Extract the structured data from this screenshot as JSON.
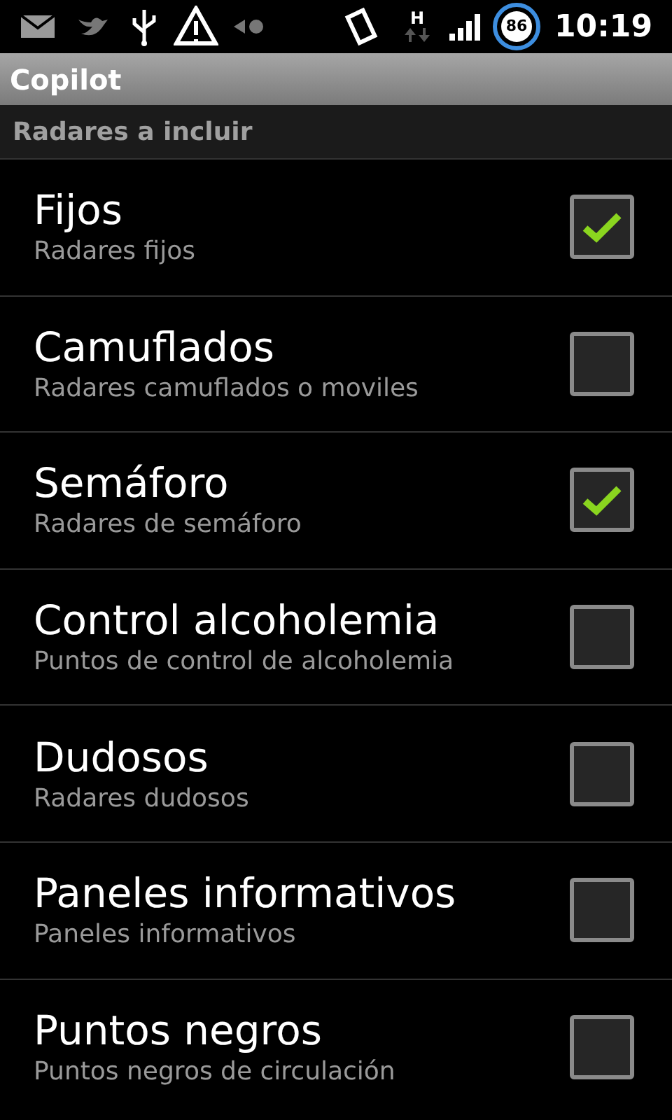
{
  "status_bar": {
    "network_type": "H",
    "battery": "86",
    "time": "10:19"
  },
  "title": "Copilot",
  "section": "Radares a incluir",
  "items": [
    {
      "title": "Fijos",
      "summary": "Radares fijos",
      "checked": true
    },
    {
      "title": "Camuflados",
      "summary": "Radares camuflados o moviles",
      "checked": false
    },
    {
      "title": "Semáforo",
      "summary": "Radares de semáforo",
      "checked": true
    },
    {
      "title": "Control alcoholemia",
      "summary": "Puntos de control de alcoholemia",
      "checked": false
    },
    {
      "title": "Dudosos",
      "summary": "Radares dudosos",
      "checked": false
    },
    {
      "title": "Paneles informativos",
      "summary": "Paneles informativos",
      "checked": false
    },
    {
      "title": "Puntos negros",
      "summary": "Puntos negros de circulación",
      "checked": false
    }
  ]
}
